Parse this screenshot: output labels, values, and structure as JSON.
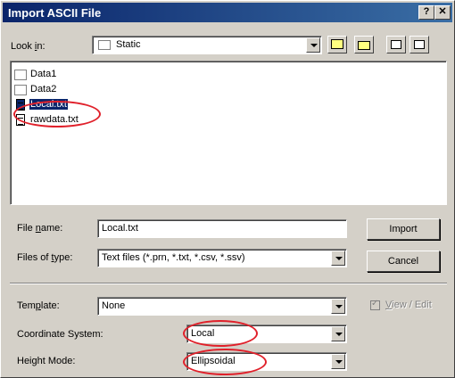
{
  "window": {
    "title": "Import ASCII File",
    "help_button": "?",
    "close_button": "✕"
  },
  "toolbar": {
    "look_in_label_pre": "Look ",
    "look_in_label_u": "i",
    "look_in_label_post": "n:",
    "look_in_value": "Static",
    "icons": [
      "up-folder-icon",
      "new-folder-icon",
      "list-view-icon",
      "details-view-icon"
    ]
  },
  "files": [
    {
      "name": "Data1",
      "type": "folder",
      "selected": false
    },
    {
      "name": "Data2",
      "type": "folder",
      "selected": false
    },
    {
      "name": "Local.txt",
      "type": "text",
      "selected": true
    },
    {
      "name": "rawdata.txt",
      "type": "text",
      "selected": false
    }
  ],
  "form": {
    "file_name_label_pre": "File ",
    "file_name_label_u": "n",
    "file_name_label_post": "ame:",
    "file_name_value": "Local.txt",
    "files_of_type_label_pre": "Files of ",
    "files_of_type_label_u": "t",
    "files_of_type_label_post": "ype:",
    "files_of_type_value": "Text files (*.prn, *.txt, *.csv, *.ssv)",
    "import_button": "Import",
    "cancel_button": "Cancel"
  },
  "options": {
    "template_label_pre": "Tem",
    "template_label_u": "p",
    "template_label_post": "late:",
    "template_value": "None",
    "view_edit_label_pre": "",
    "view_edit_label_u": "V",
    "view_edit_label_post": "iew / Edit",
    "view_edit_checked": true,
    "coordinate_system_label": "Coordinate System:",
    "coordinate_system_value": "Local",
    "height_mode_label": "Height Mode:",
    "height_mode_value": "Ellipsoidal"
  },
  "colors": {
    "titlebar": "#0a246a",
    "highlight": "#0a246a",
    "annotation": "#e0202a",
    "face": "#d4d0c8"
  }
}
